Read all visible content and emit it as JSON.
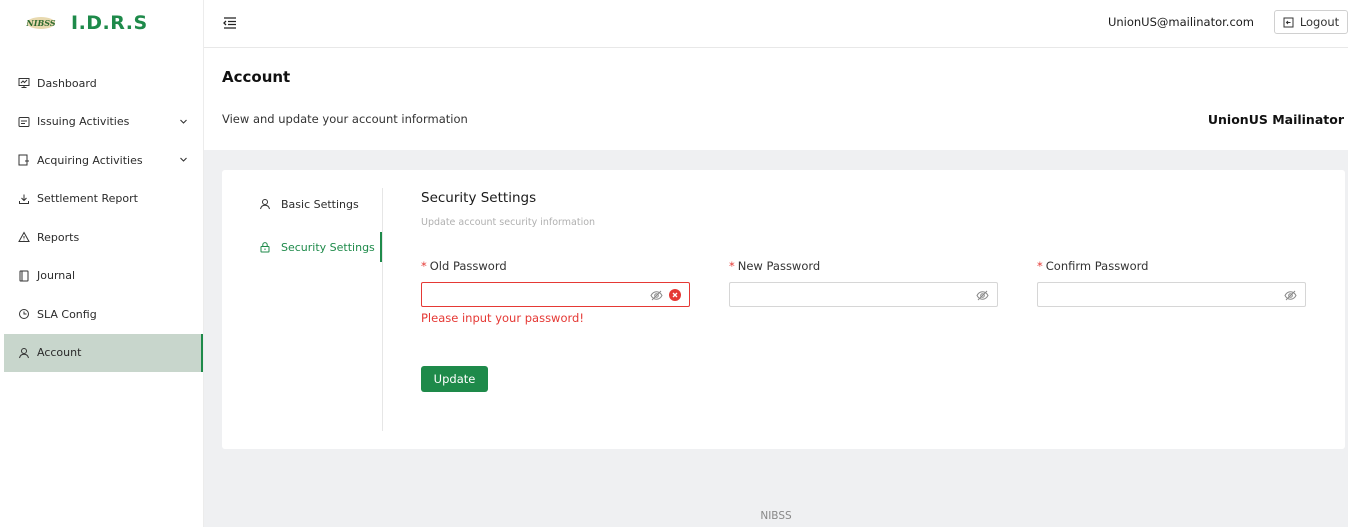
{
  "app": {
    "logo_mark": "NIBSS",
    "title": "I.D.R.S"
  },
  "sidebar": {
    "items": [
      {
        "label": "Dashboard",
        "icon": "dashboard-icon"
      },
      {
        "label": "Issuing Activities",
        "icon": "issuing-icon",
        "expandable": true
      },
      {
        "label": "Acquiring Activities",
        "icon": "acquiring-icon",
        "expandable": true
      },
      {
        "label": "Settlement Report",
        "icon": "download-icon"
      },
      {
        "label": "Reports",
        "icon": "warning-icon"
      },
      {
        "label": "Journal",
        "icon": "book-icon"
      },
      {
        "label": "SLA Config",
        "icon": "clock-icon"
      },
      {
        "label": "Account",
        "icon": "user-icon",
        "active": true
      }
    ]
  },
  "header": {
    "user_email": "UnionUS@mailinator.com",
    "logout_label": "Logout"
  },
  "page": {
    "title": "Account",
    "subtitle": "View and update your account information",
    "org_name": "UnionUS Mailinator"
  },
  "tabs": [
    {
      "label": "Basic Settings",
      "icon": "user-icon"
    },
    {
      "label": "Security Settings",
      "icon": "lock-icon",
      "active": true
    }
  ],
  "security": {
    "title": "Security Settings",
    "subtitle": "Update account security information",
    "fields": [
      {
        "label": "Old Password",
        "value": "",
        "error": "Please input your password!"
      },
      {
        "label": "New Password",
        "value": ""
      },
      {
        "label": "Confirm Password",
        "value": ""
      }
    ],
    "required_mark": "*",
    "update_label": "Update"
  },
  "footer": {
    "text": "NIBSS"
  },
  "colors": {
    "brand": "#1e8a4a",
    "error": "#e53935",
    "active_bg": "#c8d6cc"
  }
}
